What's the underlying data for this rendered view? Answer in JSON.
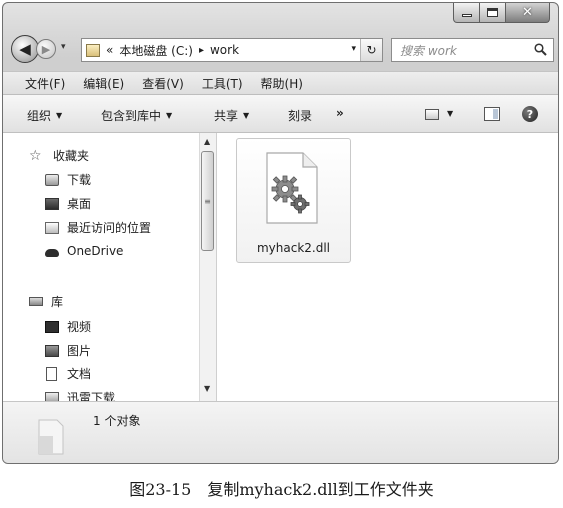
{
  "window": {
    "caption_min": "–",
    "caption_close": "✕"
  },
  "nav": {
    "back_glyph": "◀",
    "forward_glyph": "▶",
    "address": {
      "overflow": "«",
      "segments": [
        "本地磁盘 (C:)",
        "work"
      ],
      "separator": "▸",
      "refresh_glyph": "↻"
    },
    "search": {
      "placeholder": "搜索 work"
    }
  },
  "menubar": {
    "items": [
      "文件(F)",
      "编辑(E)",
      "查看(V)",
      "工具(T)",
      "帮助(H)"
    ]
  },
  "cmdbar": {
    "organize": "组织",
    "include_library": "包含到库中",
    "share": "共享",
    "burn": "刻录",
    "more": "»",
    "help_glyph": "?"
  },
  "navpane": {
    "favorites": "收藏夹",
    "downloads": "下载",
    "desktop": "桌面",
    "recent": "最近访问的位置",
    "onedrive": "OneDrive",
    "libraries": "库",
    "videos": "视频",
    "pictures": "图片",
    "documents": "文档",
    "thunder": "迅雷下载"
  },
  "content": {
    "files": [
      {
        "name": "myhack2.dll",
        "icon": "dll-gear-icon"
      }
    ]
  },
  "details": {
    "count": "1 个对象"
  },
  "caption": "图23-15　复制myhack2.dll到工作文件夹",
  "colors": {
    "window_frame": "#cfcfcf",
    "tile_border": "#c9c9c9"
  }
}
